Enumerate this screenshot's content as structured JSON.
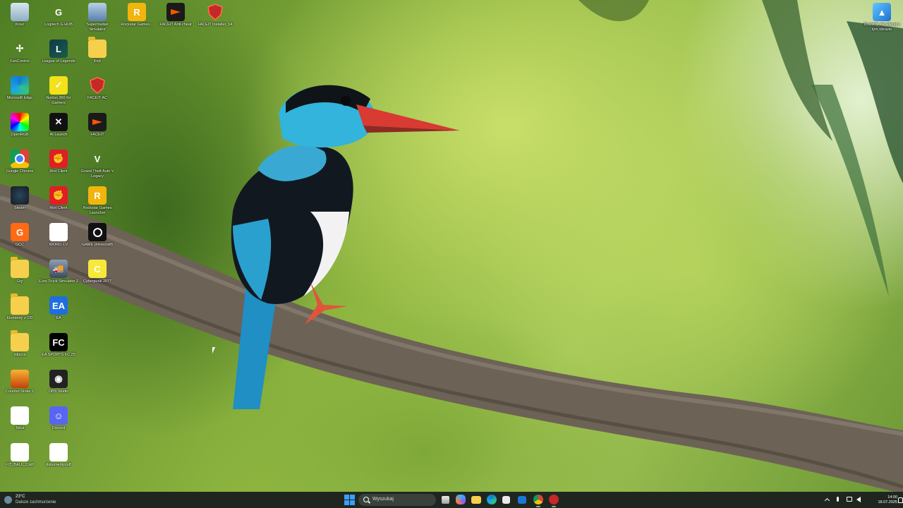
{
  "desktop": {
    "icons": [
      {
        "label": "Kosz"
      },
      {
        "label": "Logitech G HUB"
      },
      {
        "label": "Supermarket Simulator"
      },
      {
        "label": "Rockstar Games..."
      },
      {
        "label": "FACEIT Anti-cheat"
      },
      {
        "label": "FACEIT Installer_64"
      },
      {
        "label": "FanControl"
      },
      {
        "label": "League of Legends"
      },
      {
        "label": "Kick"
      },
      {
        "label": "Microsoft Edge"
      },
      {
        "label": "Norton 360 for Gamers"
      },
      {
        "label": "FACEIT AC"
      },
      {
        "label": "OpenRGB"
      },
      {
        "label": "AI Launch"
      },
      {
        "label": "FACEIT"
      },
      {
        "label": "Google Chrome"
      },
      {
        "label": "Riot Client"
      },
      {
        "label": "Grand Theft Auto V Legacy"
      },
      {
        "label": "Steam"
      },
      {
        "label": "Riot Client"
      },
      {
        "label": "Rockstar Games Launcher"
      },
      {
        "label": "GCC"
      },
      {
        "label": "WORD CV"
      },
      {
        "label": "GAME (minecraft)"
      },
      {
        "label": "Gry"
      },
      {
        "label": "Euro Truck Simulator 2"
      },
      {
        "label": "Cyberpunk 2077"
      },
      {
        "label": "Elementy z OD"
      },
      {
        "label": "EA"
      },
      {
        "label": "zdjecia"
      },
      {
        "label": "EA SPORTS FC 25"
      },
      {
        "label": "Counter-Strike 2"
      },
      {
        "label": "OBS Studio"
      },
      {
        "label": "Tekst"
      },
      {
        "label": "Discord"
      },
      {
        "label": "FIT_BALL_2.pdf"
      },
      {
        "label": "dokumenty.pdf"
      }
    ],
    "top_right_notice": "Dowiedz się więcej o tym obrazie"
  },
  "taskbar": {
    "weather": {
      "temp": "23°C",
      "desc": "Dalsze zachmurzenie"
    },
    "search_placeholder": "Wyszukaj",
    "clock": {
      "time": "14:00",
      "date": "18.07.2025"
    }
  }
}
